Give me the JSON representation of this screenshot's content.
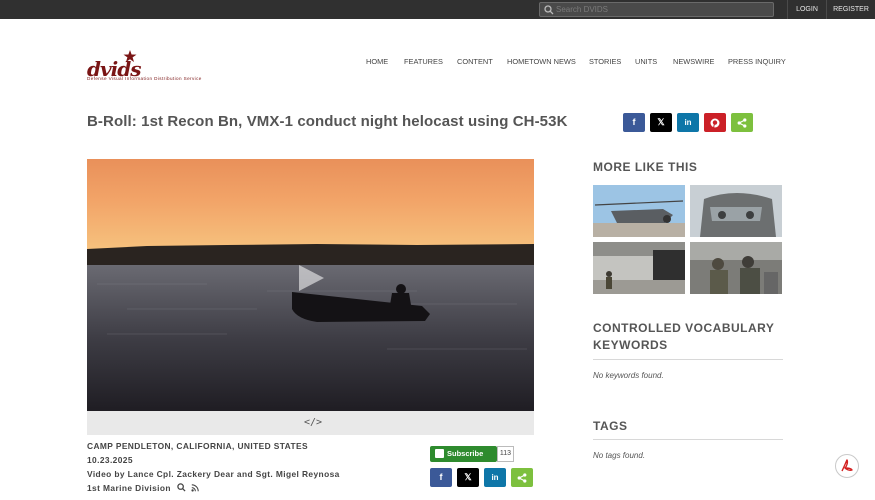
{
  "topbar": {
    "search_placeholder": "Search DVIDS",
    "login": "LOGIN",
    "register": "REGISTER"
  },
  "logo": {
    "wordmark": "dvids",
    "tagline": "Defense Visual Information Distribution Service"
  },
  "nav": [
    "HOME",
    "FEATURES",
    "CONTENT",
    "HOMETOWN NEWS",
    "STORIES",
    "UNITS",
    "NEWSWIRE",
    "PRESS INQUIRY"
  ],
  "title": "B-Roll: 1st Recon Bn, VMX-1 conduct night helocast using CH-53K",
  "share_icons": [
    "facebook-icon",
    "x-icon",
    "linkedin-icon",
    "pinterest-icon",
    "share-icon"
  ],
  "video": {
    "embed_icon": "</>"
  },
  "meta": {
    "location": "CAMP PENDLETON, CALIFORNIA, UNITED STATES",
    "date": "10.23.2025",
    "credit": "Video by Lance Cpl. Zackery Dear and Sgt. Migel Reynosa",
    "unit": "1st Marine Division"
  },
  "subscribe": {
    "label": "Subscribe",
    "count": "113"
  },
  "sidebar": {
    "more_heading": "MORE LIKE THIS",
    "vocab_heading_line1": "CONTROLLED VOCABULARY",
    "vocab_heading_line2": "KEYWORDS",
    "vocab_empty": "No keywords found.",
    "tags_heading": "TAGS",
    "tags_empty": "No tags found."
  },
  "colors": {
    "topbar": "#303030",
    "brand": "#7a1515",
    "subscribe": "#2e8b2e",
    "facebook": "#3b5998",
    "x": "#000000",
    "linkedin": "#0e76a8",
    "pinterest": "#cb2027",
    "share": "#7dc03e"
  }
}
